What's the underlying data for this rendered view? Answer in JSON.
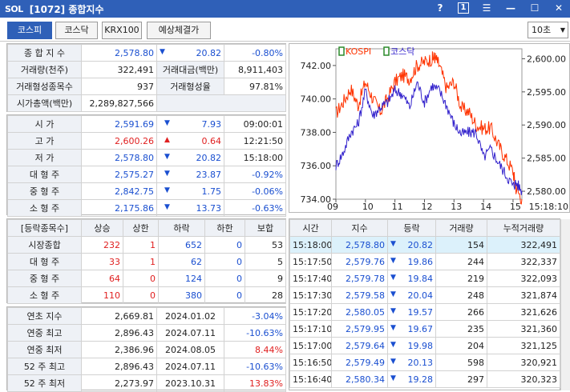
{
  "window": {
    "logo": "SOL",
    "title": "[1072] 종합지수",
    "help": "?",
    "one": "1"
  },
  "tabs": [
    {
      "label": "코스피"
    },
    {
      "label": "코스닥"
    },
    {
      "label": "KRX100"
    },
    {
      "label": "예상체결가"
    }
  ],
  "interval": "10초",
  "summary": {
    "index_label": "종 합 지 수",
    "index_value": "2,578.80",
    "index_change": "20.82",
    "index_rate": "-0.80%",
    "volume_label": "거래량(천주)",
    "volume_value": "322,491",
    "amount_label": "거래대금(백만)",
    "amount_value": "8,911,403",
    "traded_label": "거래형성종목수",
    "traded_value": "937",
    "traded_rate_label": "거래형성율",
    "traded_rate_value": "97.81%",
    "mcap_label": "시가총액(백만)",
    "mcap_value": "2,289,827,566"
  },
  "prices": [
    {
      "label": "시   가",
      "value": "2,591.69",
      "dir": "down",
      "change": "7.93",
      "extra": "09:00:01",
      "color": "blue"
    },
    {
      "label": "고   가",
      "value": "2,600.26",
      "dir": "up",
      "change": "0.64",
      "extra": "12:21:50",
      "color": "red"
    },
    {
      "label": "저   가",
      "value": "2,578.80",
      "dir": "down",
      "change": "20.82",
      "extra": "15:18:00",
      "color": "blue"
    },
    {
      "label": "대 형 주",
      "value": "2,575.27",
      "dir": "down",
      "change": "23.87",
      "extra": "-0.92%",
      "color": "blue"
    },
    {
      "label": "중 형 주",
      "value": "2,842.75",
      "dir": "down",
      "change": "1.75",
      "extra": "-0.06%",
      "color": "blue"
    },
    {
      "label": "소 형 주",
      "value": "2,175.86",
      "dir": "down",
      "change": "13.73",
      "extra": "-0.63%",
      "color": "blue"
    }
  ],
  "breadth": {
    "headers": [
      "[등락종목수]",
      "상승",
      "상한",
      "하락",
      "하한",
      "보합"
    ],
    "rows": [
      {
        "label": "시장종합",
        "v": [
          "232",
          "1",
          "652",
          "0",
          "53"
        ]
      },
      {
        "label": "대 형 주",
        "v": [
          "33",
          "1",
          "62",
          "0",
          "5"
        ]
      },
      {
        "label": "중 형 주",
        "v": [
          "64",
          "0",
          "124",
          "0",
          "9"
        ]
      },
      {
        "label": "소 형 주",
        "v": [
          "110",
          "0",
          "380",
          "0",
          "28"
        ]
      }
    ]
  },
  "yearly": [
    {
      "label": "연초  지수",
      "value": "2,669.81",
      "date": "2024.01.02",
      "rate": "-3.04%",
      "color": "blue"
    },
    {
      "label": "연중  최고",
      "value": "2,896.43",
      "date": "2024.07.11",
      "rate": "-10.63%",
      "color": "blue"
    },
    {
      "label": "연중  최저",
      "value": "2,386.96",
      "date": "2024.08.05",
      "rate": "8.44%",
      "color": "red"
    },
    {
      "label": "52 주 최고",
      "value": "2,896.43",
      "date": "2024.07.11",
      "rate": "-10.63%",
      "color": "blue"
    },
    {
      "label": "52 주 최저",
      "value": "2,273.97",
      "date": "2023.10.31",
      "rate": "13.83%",
      "color": "red"
    }
  ],
  "ticks": {
    "headers": [
      "시간",
      "지수",
      "등락",
      "거래량",
      "누적거래량"
    ],
    "rows": [
      {
        "time": "15:18:00",
        "index": "2,578.80",
        "change": "20.82",
        "vol": "154",
        "cum": "322,491"
      },
      {
        "time": "15:17:50",
        "index": "2,579.76",
        "change": "19.86",
        "vol": "244",
        "cum": "322,337"
      },
      {
        "time": "15:17:40",
        "index": "2,579.78",
        "change": "19.84",
        "vol": "219",
        "cum": "322,093"
      },
      {
        "time": "15:17:30",
        "index": "2,579.58",
        "change": "20.04",
        "vol": "248",
        "cum": "321,874"
      },
      {
        "time": "15:17:20",
        "index": "2,580.05",
        "change": "19.57",
        "vol": "266",
        "cum": "321,626"
      },
      {
        "time": "15:17:10",
        "index": "2,579.95",
        "change": "19.67",
        "vol": "235",
        "cum": "321,360"
      },
      {
        "time": "15:17:00",
        "index": "2,579.64",
        "change": "19.98",
        "vol": "204",
        "cum": "321,125"
      },
      {
        "time": "15:16:50",
        "index": "2,579.49",
        "change": "20.13",
        "vol": "598",
        "cum": "320,921"
      },
      {
        "time": "15:16:40",
        "index": "2,580.34",
        "change": "19.28",
        "vol": "297",
        "cum": "320,323"
      }
    ]
  },
  "chart_data": {
    "type": "line",
    "legend": [
      "KOSPI",
      "코스닥"
    ],
    "x_ticks": [
      "09",
      "10",
      "11",
      "12",
      "13",
      "14",
      "15",
      "15:18:10"
    ],
    "left_ticks": [
      "742.00",
      "740.00",
      "738.00",
      "736.00",
      "734.00"
    ],
    "right_ticks": [
      "2,600.00",
      "2,595.00",
      "2,590.00",
      "2,585.00",
      "2,580.00"
    ],
    "left_ylim": [
      734,
      743
    ],
    "right_ylim": [
      2578.8,
      2601.5
    ],
    "series": [
      {
        "name": "KOSPI",
        "color": "#ff3300",
        "axis": "right",
        "x": [
          9.0,
          9.25,
          9.5,
          9.75,
          10.0,
          10.25,
          10.5,
          10.75,
          11.0,
          11.25,
          11.5,
          11.75,
          12.0,
          12.25,
          12.35,
          12.5,
          12.75,
          13.0,
          13.25,
          13.5,
          13.75,
          14.0,
          14.25,
          14.5,
          14.75,
          15.0,
          15.1,
          15.3
        ],
        "y": [
          2591.7,
          2593.5,
          2595.5,
          2593.0,
          2596.5,
          2594.0,
          2592.0,
          2594.0,
          2596.5,
          2597.5,
          2597.0,
          2599.0,
          2599.5,
          2600.0,
          2600.26,
          2599.0,
          2595.5,
          2596.5,
          2592.5,
          2592.0,
          2590.0,
          2589.5,
          2589.5,
          2587.0,
          2585.0,
          2583.0,
          2580.5,
          2578.8
        ]
      },
      {
        "name": "코스닥",
        "color": "#3322cc",
        "axis": "left",
        "x": [
          9.0,
          9.25,
          9.5,
          9.75,
          10.0,
          10.25,
          10.5,
          10.75,
          11.0,
          11.25,
          11.5,
          11.75,
          12.0,
          12.25,
          12.5,
          12.75,
          13.0,
          13.25,
          13.5,
          13.75,
          14.0,
          14.25,
          14.5,
          14.75,
          15.0,
          15.1,
          15.3
        ],
        "y": [
          736.0,
          736.8,
          738.0,
          738.5,
          740.5,
          739.0,
          739.5,
          739.8,
          740.5,
          740.3,
          739.5,
          741.0,
          739.8,
          740.8,
          740.5,
          739.6,
          738.5,
          737.9,
          738.0,
          738.0,
          736.5,
          737.0,
          736.2,
          735.5,
          734.8,
          735.0,
          734.5
        ]
      }
    ]
  }
}
